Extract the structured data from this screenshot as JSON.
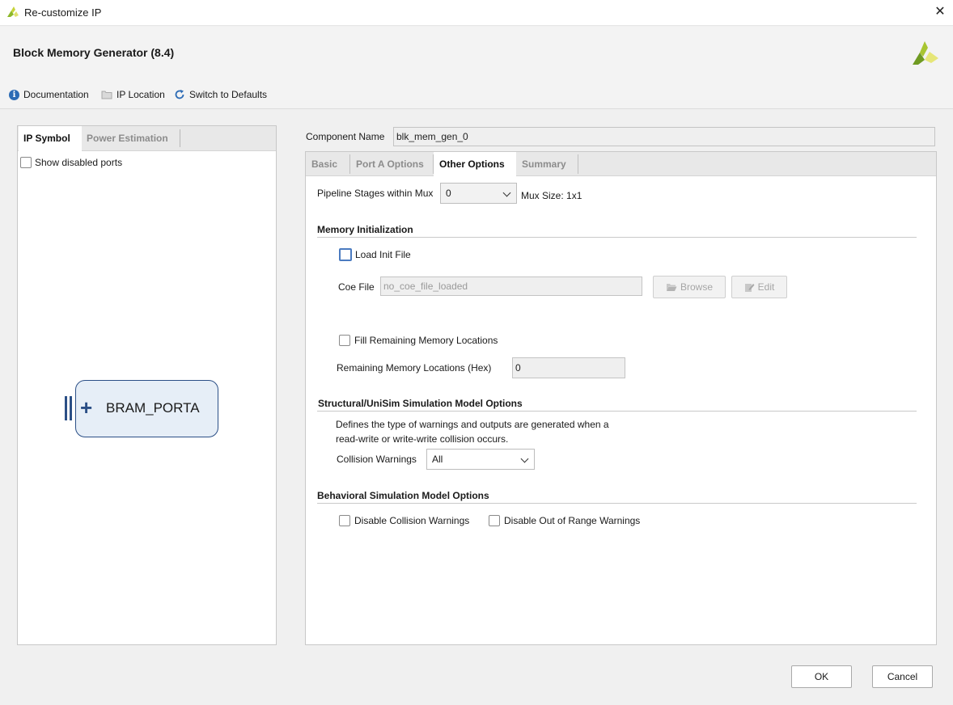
{
  "window": {
    "title": "Re-customize IP",
    "close_label": "✕"
  },
  "header": {
    "ip_title": "Block Memory Generator (8.4)"
  },
  "toolbar": {
    "documentation": "Documentation",
    "ip_location": "IP Location",
    "switch_defaults": "Switch to Defaults"
  },
  "left": {
    "tabs": [
      "IP Symbol",
      "Power Estimation"
    ],
    "active_tab": "IP Symbol",
    "show_disabled_ports": "Show disabled ports",
    "symbol_label": "BRAM_PORTA",
    "symbol_plus": "+"
  },
  "component": {
    "label": "Component Name",
    "value": "blk_mem_gen_0"
  },
  "right": {
    "tabs": [
      "Basic",
      "Port A Options",
      "Other Options",
      "Summary"
    ],
    "active_tab": "Other Options",
    "pipeline": {
      "label": "Pipeline Stages within Mux",
      "value": "0",
      "mux_size": "Mux Size: 1x1"
    },
    "memory_init": {
      "title": "Memory Initialization",
      "load_init_file": "Load Init File",
      "coe_label": "Coe File",
      "coe_placeholder": "no_coe_file_loaded",
      "browse": "Browse",
      "edit": "Edit",
      "fill_remaining": "Fill Remaining Memory Locations",
      "remaining_label": "Remaining Memory Locations (Hex)",
      "remaining_value": "0"
    },
    "structural": {
      "title": "Structural/UniSim Simulation Model Options",
      "desc_line1": "Defines the type of warnings and outputs are generated when a",
      "desc_line2": "read-write or write-write collision occurs.",
      "collision_label": "Collision Warnings",
      "collision_value": "All"
    },
    "behavioral": {
      "title": "Behavioral Simulation Model Options",
      "disable_collision": "Disable Collision Warnings",
      "disable_range": "Disable Out of Range Warnings"
    }
  },
  "footer": {
    "ok": "OK",
    "cancel": "Cancel"
  },
  "colors": {
    "accent": "#2c6bb5",
    "brand_green": "#8db82a",
    "symbol_border": "#2b4f86"
  }
}
